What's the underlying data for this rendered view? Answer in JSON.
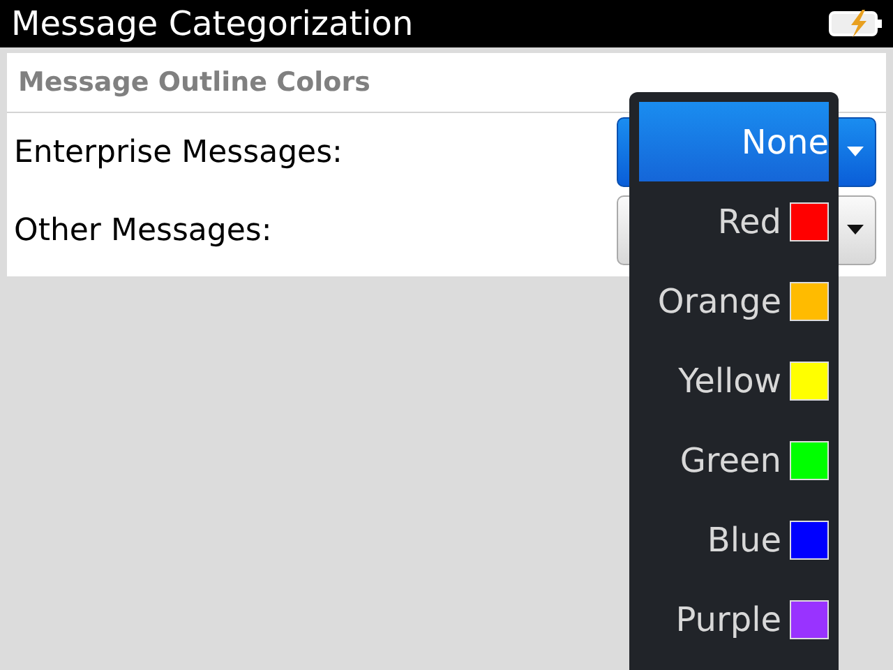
{
  "window": {
    "title": "Message Categorization"
  },
  "section": {
    "heading": "Message Outline Colors"
  },
  "settings": [
    {
      "label": "Enterprise Messages:",
      "focused": true
    },
    {
      "label": "Other Messages:",
      "focused": false
    }
  ],
  "menu": {
    "items": [
      {
        "label": "None",
        "selected": true
      },
      {
        "label": "Red",
        "selected": false,
        "color": "#ff0000"
      },
      {
        "label": "Orange",
        "selected": false,
        "color": "#ffbb00"
      },
      {
        "label": "Yellow",
        "selected": false,
        "color": "#ffff00"
      },
      {
        "label": "Green",
        "selected": false,
        "color": "#00ff00"
      },
      {
        "label": "Blue",
        "selected": false,
        "color": "#0000ff"
      },
      {
        "label": "Purple",
        "selected": false,
        "color": "#9933ff"
      }
    ]
  }
}
